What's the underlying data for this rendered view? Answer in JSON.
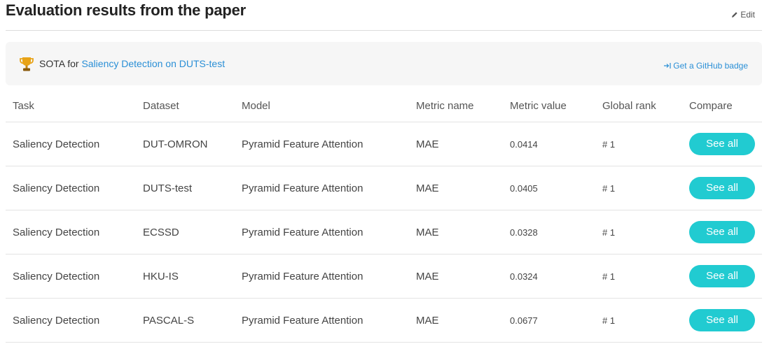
{
  "header": {
    "title": "Evaluation results from the paper",
    "edit_label": "Edit"
  },
  "sota": {
    "prefix": "SOTA for",
    "link_text": "Saliency Detection on DUTS-test",
    "badge_label": "Get a GitHub badge",
    "icon": "trophy-icon"
  },
  "table": {
    "columns": [
      "Task",
      "Dataset",
      "Model",
      "Metric name",
      "Metric value",
      "Global rank",
      "Compare"
    ],
    "rows": [
      {
        "task": "Saliency Detection",
        "dataset": "DUT-OMRON",
        "model": "Pyramid Feature Attention",
        "metric_name": "MAE",
        "metric_value": "0.0414",
        "rank": "# 1",
        "compare": "See all"
      },
      {
        "task": "Saliency Detection",
        "dataset": "DUTS-test",
        "model": "Pyramid Feature Attention",
        "metric_name": "MAE",
        "metric_value": "0.0405",
        "rank": "# 1",
        "compare": "See all"
      },
      {
        "task": "Saliency Detection",
        "dataset": "ECSSD",
        "model": "Pyramid Feature Attention",
        "metric_name": "MAE",
        "metric_value": "0.0328",
        "rank": "# 1",
        "compare": "See all"
      },
      {
        "task": "Saliency Detection",
        "dataset": "HKU-IS",
        "model": "Pyramid Feature Attention",
        "metric_name": "MAE",
        "metric_value": "0.0324",
        "rank": "# 1",
        "compare": "See all"
      },
      {
        "task": "Saliency Detection",
        "dataset": "PASCAL-S",
        "model": "Pyramid Feature Attention",
        "metric_name": "MAE",
        "metric_value": "0.0677",
        "rank": "# 1",
        "compare": "See all"
      }
    ]
  },
  "colors": {
    "accent_button": "#21cbd1",
    "link": "#2a8fd6",
    "trophy": "#e8a317"
  }
}
